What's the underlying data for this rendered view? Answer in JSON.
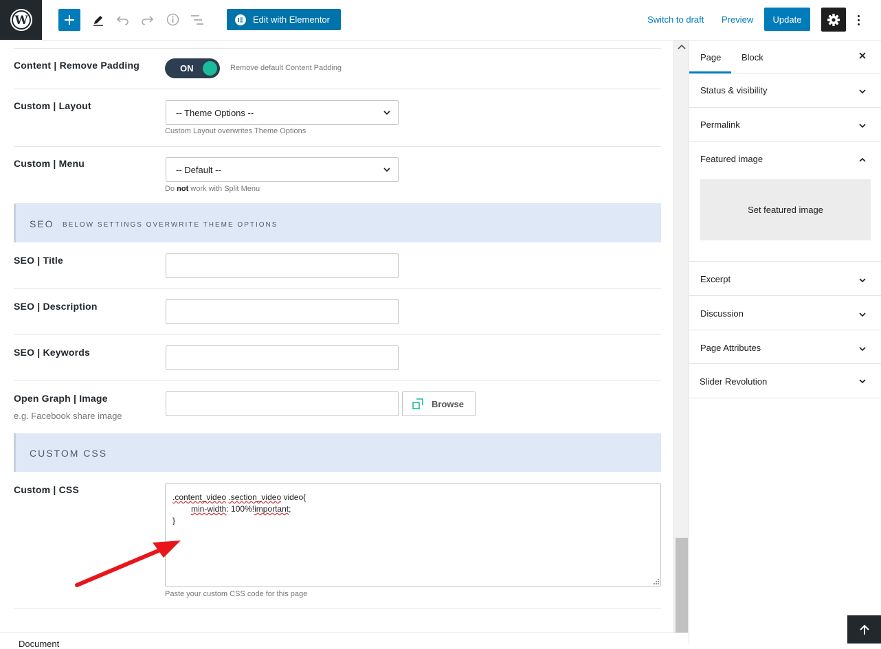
{
  "toolbar": {
    "edit_elementor_label": "Edit with Elementor",
    "switch_draft_label": "Switch to draft",
    "preview_label": "Preview",
    "update_label": "Update"
  },
  "fields": {
    "remove_padding": {
      "label": "Content | Remove Padding",
      "toggle": "ON",
      "hint": "Remove default Content Padding"
    },
    "layout": {
      "label": "Custom | Layout",
      "value": "-- Theme Options --",
      "hint": "Custom Layout overwrites Theme Options"
    },
    "menu": {
      "label": "Custom | Menu",
      "value": "-- Default --",
      "hint_pre": "Do ",
      "hint_bold": "not",
      "hint_post": " work with Split Menu"
    },
    "seo_section": {
      "title": "SEO",
      "subtitle": "BELOW SETTINGS OVERWRITE THEME OPTIONS"
    },
    "seo_title": {
      "label": "SEO | Title"
    },
    "seo_description": {
      "label": "SEO | Description"
    },
    "seo_keywords": {
      "label": "SEO | Keywords"
    },
    "og_image": {
      "label": "Open Graph | Image",
      "sublabel": "e.g. Facebook share image",
      "browse": "Browse"
    },
    "css_section": {
      "title": "CUSTOM CSS"
    },
    "custom_css": {
      "label": "Custom | CSS",
      "line1_a": ".content_video",
      "line1_b": " ",
      "line1_c": ".section_video",
      "line1_d": " video{",
      "line2_a": "min-width",
      "line2_b": ": 100%!",
      "line2_c": "important",
      "line2_d": ";",
      "line3": "}",
      "hint": "Paste your custom CSS code for this page"
    }
  },
  "sidebar": {
    "tabs": [
      "Page",
      "Block"
    ],
    "panels": [
      "Status & visibility",
      "Permalink",
      "Featured image",
      "Excerpt",
      "Discussion",
      "Page Attributes",
      "Slider Revolution"
    ],
    "featured_button": "Set featured image"
  },
  "footer": {
    "label": "Document"
  },
  "colors": {
    "primary": "#007cba",
    "elementor": "#0073aa",
    "section_bg": "#dee8f6",
    "toggle_on": "#1abc9c",
    "annotation_arrow": "#e8161b"
  }
}
